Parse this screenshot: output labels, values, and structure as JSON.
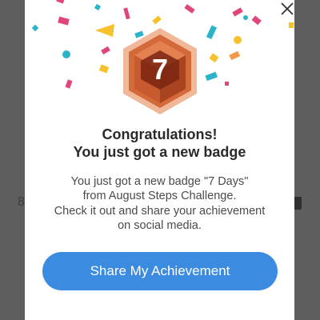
{
  "background": {
    "left_glyph": "8"
  },
  "dialog": {
    "close_icon": "close-icon",
    "badge": {
      "number": "7",
      "colors": {
        "outer": "#e8a07d",
        "face": "#c75a2e",
        "inner": "#7a2510"
      }
    },
    "headline_line1": "Congratulations!",
    "headline_line2": "You just got a new badge",
    "body_lines": [
      "You just got a new badge \"7 Days\"",
      "from August Steps Challenge.",
      "Check it out and share your achievement",
      "on social media."
    ],
    "share_button_label": "Share My Achievement"
  },
  "colors": {
    "accent": "#3b8be0",
    "overlay": "#5e5e5e",
    "confetti": [
      "#e0467c",
      "#f6c12a",
      "#2bb3c9",
      "#f39a4a",
      "#4a8fe0"
    ]
  }
}
